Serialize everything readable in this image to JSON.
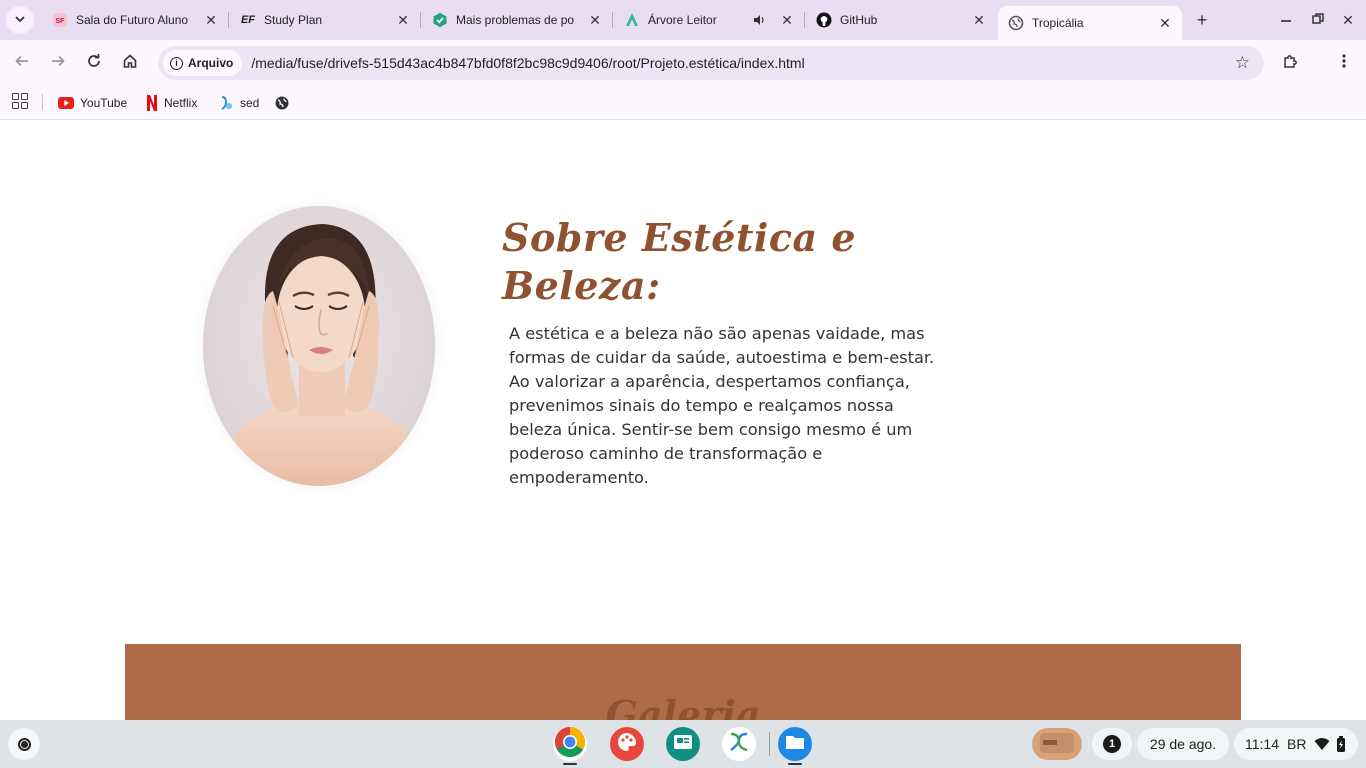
{
  "tabs": [
    {
      "title": "Sala do Futuro Aluno",
      "icon": "sala-futuro-icon"
    },
    {
      "title": "Study Plan",
      "icon": "ef-icon"
    },
    {
      "title": "Mais problemas de po",
      "icon": "hex-check-icon"
    },
    {
      "title": "Árvore Leitor",
      "icon": "arvore-icon"
    },
    {
      "title": "GitHub",
      "icon": "github-icon"
    },
    {
      "title": "Tropicália",
      "icon": "globe-icon"
    }
  ],
  "ef_badge": "EF",
  "address": {
    "chip_label": "Arquivo",
    "url": "/media/fuse/drivefs-515d43ac4b847bfd0f8f2bc98c9d9406/root/Projeto.estética/index.html"
  },
  "bookmarks": [
    {
      "label": "YouTube"
    },
    {
      "label": "Netflix"
    },
    {
      "label": "sed"
    }
  ],
  "page": {
    "about_title": "Sobre Estética e Beleza:",
    "about_text": "A estética e a beleza não são apenas vaidade, mas formas de cuidar da saúde, autoestima e bem-estar. Ao valorizar a aparência, despertamos confiança, prevenimos sinais do tempo e realçamos nossa beleza única. Sentir-se bem consigo mesmo é um poderoso caminho de transformação e empoderamento.",
    "gallery_title": "Galeria"
  },
  "shelf": {
    "notification_count": "1",
    "date": "29 de ago.",
    "time": "11:14",
    "locale": "BR"
  },
  "colors": {
    "title_brown": "#8f5230",
    "gallery_bg": "#ad6b48",
    "tabstrip_bg": "#e9ddf4",
    "toolbar_bg": "#fdf7ff"
  }
}
